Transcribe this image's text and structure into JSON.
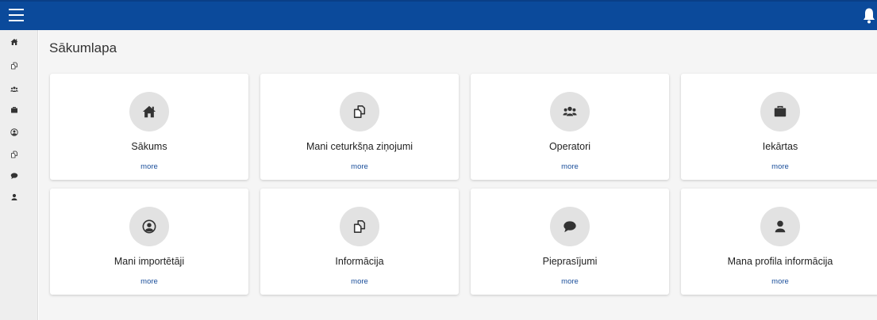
{
  "colors": {
    "topbar": "#0b4a9b",
    "sidebar": "#eeeeee",
    "main_bg": "#f5f5f5",
    "icon_circle": "#e2e2e2",
    "link": "#1a4e9a"
  },
  "topbar": {
    "menu_icon": "hamburger-icon",
    "notification_icon": "bell-icon"
  },
  "sidebar": {
    "items": [
      {
        "icon": "home-icon"
      },
      {
        "icon": "documents-icon"
      },
      {
        "icon": "users-icon"
      },
      {
        "icon": "briefcase-icon"
      },
      {
        "icon": "user-circle-icon"
      },
      {
        "icon": "documents-icon"
      },
      {
        "icon": "comment-icon"
      },
      {
        "icon": "user-icon"
      }
    ]
  },
  "main": {
    "title": "Sākumlapa",
    "cards": [
      {
        "icon": "home-icon",
        "label": "Sākums",
        "link": "more"
      },
      {
        "icon": "documents-icon",
        "label": "Mani ceturkšņa ziņojumi",
        "link": "more"
      },
      {
        "icon": "users-icon",
        "label": "Operatori",
        "link": "more"
      },
      {
        "icon": "briefcase-icon",
        "label": "Iekārtas",
        "link": "more"
      },
      {
        "icon": "user-circle-icon",
        "label": "Mani importētāji",
        "link": "more"
      },
      {
        "icon": "documents-icon",
        "label": "Informācija",
        "link": "more"
      },
      {
        "icon": "comment-icon",
        "label": "Pieprasījumi",
        "link": "more"
      },
      {
        "icon": "user-icon",
        "label": "Mana profila informācija",
        "link": "more"
      }
    ]
  }
}
